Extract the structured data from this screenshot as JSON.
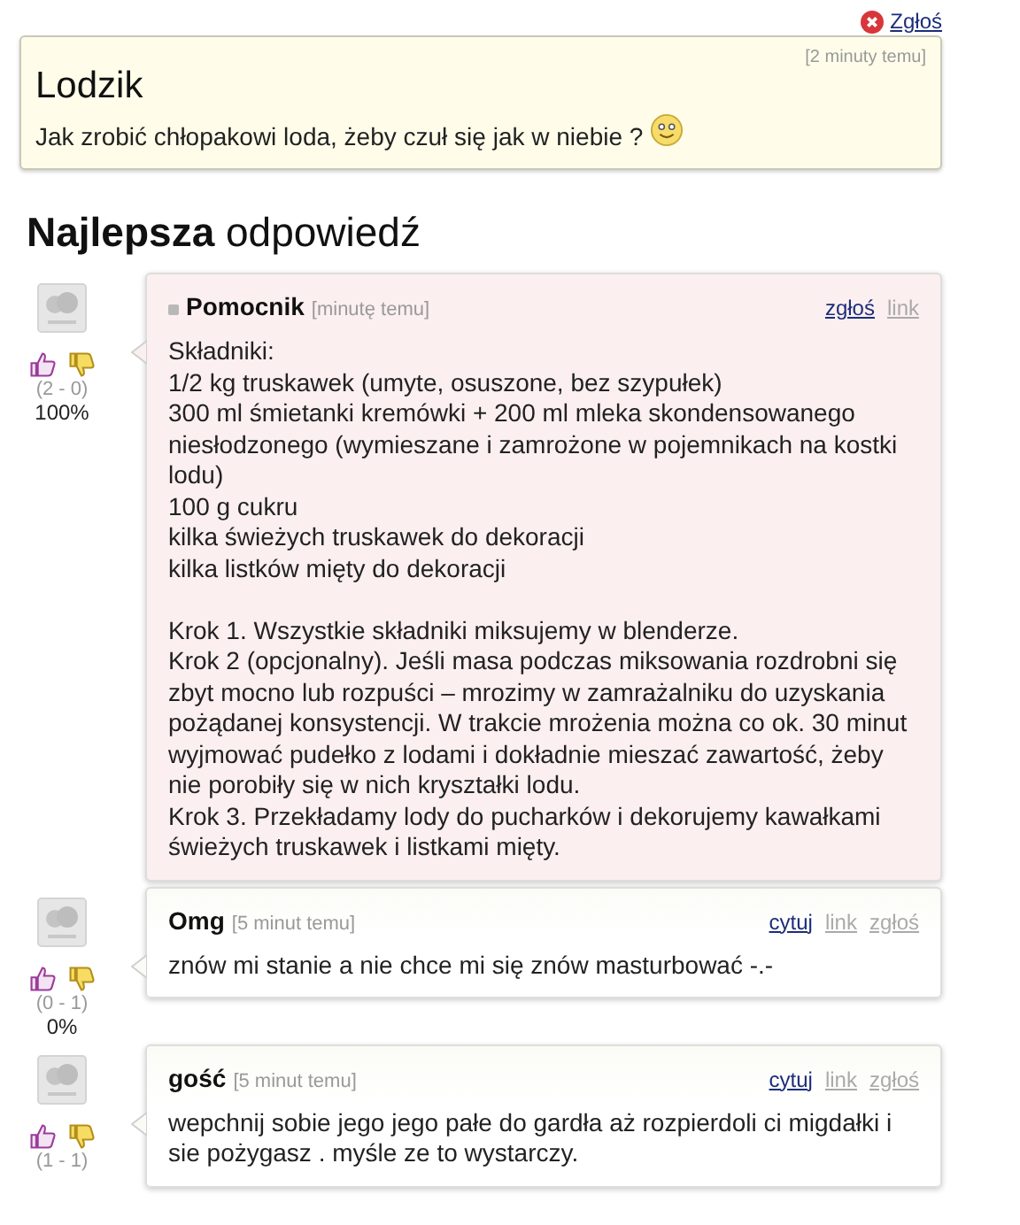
{
  "report_link": "Zgłoś",
  "question": {
    "time": "[2 minuty temu]",
    "author": "Lodzik",
    "text": "Jak zrobić chłopakowi loda, żeby czuł się jak w niebie ?"
  },
  "best_heading": "**Najlepsza** odpowiedź",
  "answers": [
    {
      "kind": "best",
      "author": "Pomocnik",
      "time": "[minutę temu]",
      "links": [
        {
          "label": "zgłoś",
          "highlighted": true
        },
        {
          "label": "link",
          "highlighted": false
        }
      ],
      "votes": "(2 - 0)",
      "percent": "100%",
      "sections": [
        [
          "Składniki:",
          "1/2 kg truskawek (umyte, osuszone, bez szypułek)",
          "300 ml śmietanki kremówki + 200 ml mleka skondensowanego niesłodzonego (wymieszane i zamrożone w pojemnikach na kostki lodu)",
          "100 g cukru",
          "kilka świeżych truskawek do dekoracji",
          "kilka listków mięty do dekoracji"
        ],
        [
          "Krok 1. Wszystkie składniki miksujemy w blenderze.",
          "Krok 2 (opcjonalny). Jeśli masa podczas miksowania rozdrobni się zbyt mocno lub rozpuści – mrozimy w zamrażalniku do uzyskania pożądanej konsystencji. W trakcie mrożenia można co ok. 30 minut wyjmować pudełko z lodami i dokładnie mieszać zawartość, żeby nie porobiły się w nich kryształki lodu.",
          "Krok 3. Przekładamy lody do pucharków i dekorujemy kawałkami świeżych truskawek i listkami mięty."
        ]
      ]
    },
    {
      "kind": "comment",
      "author": "Omg",
      "time": "[5 minut temu]",
      "links": [
        {
          "label": "cytuj",
          "highlighted": true
        },
        {
          "label": "link",
          "highlighted": false
        },
        {
          "label": "zgłoś",
          "highlighted": false
        }
      ],
      "votes": "(0 - 1)",
      "percent": "0%",
      "sections": [
        [
          "znów mi stanie a nie chce mi się znów masturbować -.-"
        ]
      ]
    },
    {
      "kind": "comment",
      "author": "gość",
      "time": "[5 minut temu]",
      "links": [
        {
          "label": "cytuj",
          "highlighted": true
        },
        {
          "label": "link",
          "highlighted": false
        },
        {
          "label": "zgłoś",
          "highlighted": false
        }
      ],
      "votes": "(1 - 1)",
      "sections": [
        [
          "wepchnij sobie jego jego pałe do gardła aż rozpierdoli ci migdałki i sie pożygasz . myśle ze to wystarczy."
        ]
      ]
    }
  ]
}
